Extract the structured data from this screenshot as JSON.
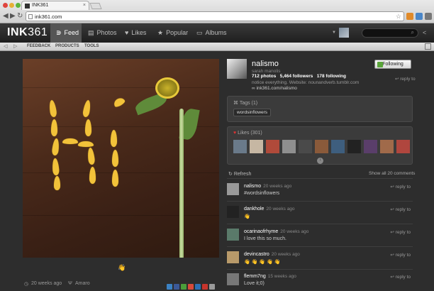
{
  "browser": {
    "tab_title": "INK361",
    "tab_close": "×",
    "url": "ink361.com",
    "back": "◀",
    "forward": "▶",
    "reload": "↻",
    "star": "☆"
  },
  "app": {
    "logo_bold": "INK",
    "logo_rest": "361",
    "nav": [
      {
        "label": "Feed",
        "icon": "feed-icon",
        "glyph": "⋑"
      },
      {
        "label": "Photos",
        "icon": "photos-icon",
        "glyph": "▤"
      },
      {
        "label": "Likes",
        "icon": "heart-icon",
        "glyph": "♥"
      },
      {
        "label": "Popular",
        "icon": "star-icon",
        "glyph": "★"
      },
      {
        "label": "Albums",
        "icon": "folder-icon",
        "glyph": "▭"
      }
    ],
    "caret": "▼",
    "search_glyph": "⌕",
    "share_glyph": "<"
  },
  "subbar": {
    "left_arrow": "◁",
    "right_arrow": "▷",
    "links": [
      "FEEDBACK",
      "PRODUCTS",
      "TOOLS"
    ]
  },
  "post": {
    "time": "20 weeks ago",
    "location": "Amaro",
    "reaction_glyph": "👋",
    "share_colors": [
      "#3b82c4",
      "#3b5998",
      "#4a9e3a",
      "#d84a3a",
      "#2d6fb2",
      "#c6342c",
      "#9a9a9a"
    ]
  },
  "profile": {
    "username": "nalismo",
    "realname": "sarah manolis",
    "photos": "712 photos",
    "followers": "5,464 followers",
    "following": "178 following",
    "bio": "notice everything. Website: nounandverb.tumblr.com",
    "link": "ink361.com/nalismo",
    "follow_label": "Following",
    "reply_label": "reply to"
  },
  "tags": {
    "title": "Tags (1)",
    "items": [
      "wordsinflowers"
    ]
  },
  "likes": {
    "title": "Likes (301)",
    "thumb_colors": [
      "#6a7a8a",
      "#c6b7a3",
      "#b04a3a",
      "#8f8f8f",
      "#4a4a4a",
      "#8a5a3a",
      "#3e5e7e",
      "#222222",
      "#5a3e6a",
      "#a06a4a",
      "#b0463e"
    ],
    "more_glyph": "↓"
  },
  "comments_header": {
    "refresh": "Refresh",
    "show_all": "Show all 20 comments"
  },
  "comments": [
    {
      "user": "nalismo",
      "time": "20 weeks ago",
      "text": "#wordsinflowers",
      "reply": "reply to",
      "avatar_color": "#999"
    },
    {
      "user": "dankhole",
      "time": "20 weeks ago",
      "text": "👋",
      "reply": "reply to",
      "avatar_color": "#222"
    },
    {
      "user": "ocarinaofrhyme",
      "time": "20 weeks ago",
      "text": "I love this so much.",
      "reply": "reply to",
      "avatar_color": "#5a7a6a"
    },
    {
      "user": "devincastro",
      "time": "20 weeks ago",
      "text": "👋 👋 👋 👋 👋",
      "reply": "reply to",
      "avatar_color": "#b89a6a"
    },
    {
      "user": "flemm7ng",
      "time": "15 weeks ago",
      "text": "Love it;0)",
      "reply": "reply to",
      "avatar_color": "#777"
    }
  ]
}
